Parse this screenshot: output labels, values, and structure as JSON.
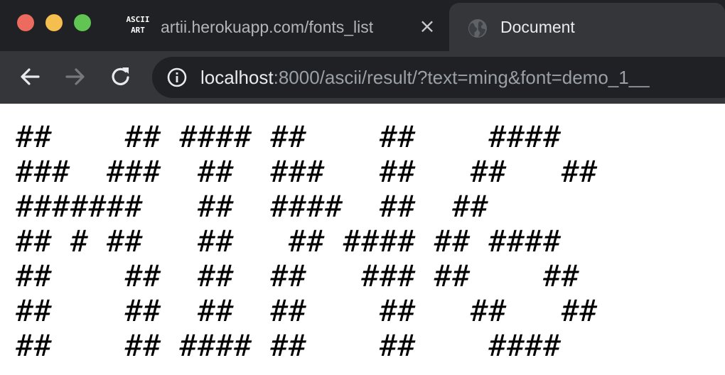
{
  "window": {
    "controls": [
      "close",
      "minimize",
      "zoom"
    ]
  },
  "tabs": [
    {
      "favicon_text_line1": "ASCII",
      "favicon_text_line2": "ART",
      "title": "artii.herokuapp.com/fonts_list",
      "close_icon": "close-icon",
      "active": false
    },
    {
      "favicon_icon": "globe-icon",
      "title": "Document",
      "active": true
    }
  ],
  "toolbar": {
    "back_icon": "back-arrow-icon",
    "forward_icon": "forward-arrow-icon",
    "reload_icon": "reload-icon",
    "info_icon": "info-icon",
    "url_host": "localhost",
    "url_rest": ":8000/ascii/result/?text=ming&font=demo_1__"
  },
  "page": {
    "ascii_art": "##    ## #### ##    ##    ####\n###  ###  ##  ###   ##   ##   ##\n#######   ##  ####  ##  ##\n## # ##   ##   ## #### ## ####\n##    ##  ##  ##   ### ##    ##\n##    ##  ##  ##    ##   ##   ##\n##    ## #### ##    ##    ####"
  },
  "colors": {
    "chrome_dark": "#202124",
    "toolbar": "#35363a",
    "close_red": "#ec6a5e",
    "minimize_yellow": "#f4bf4f",
    "zoom_green": "#61c554"
  }
}
